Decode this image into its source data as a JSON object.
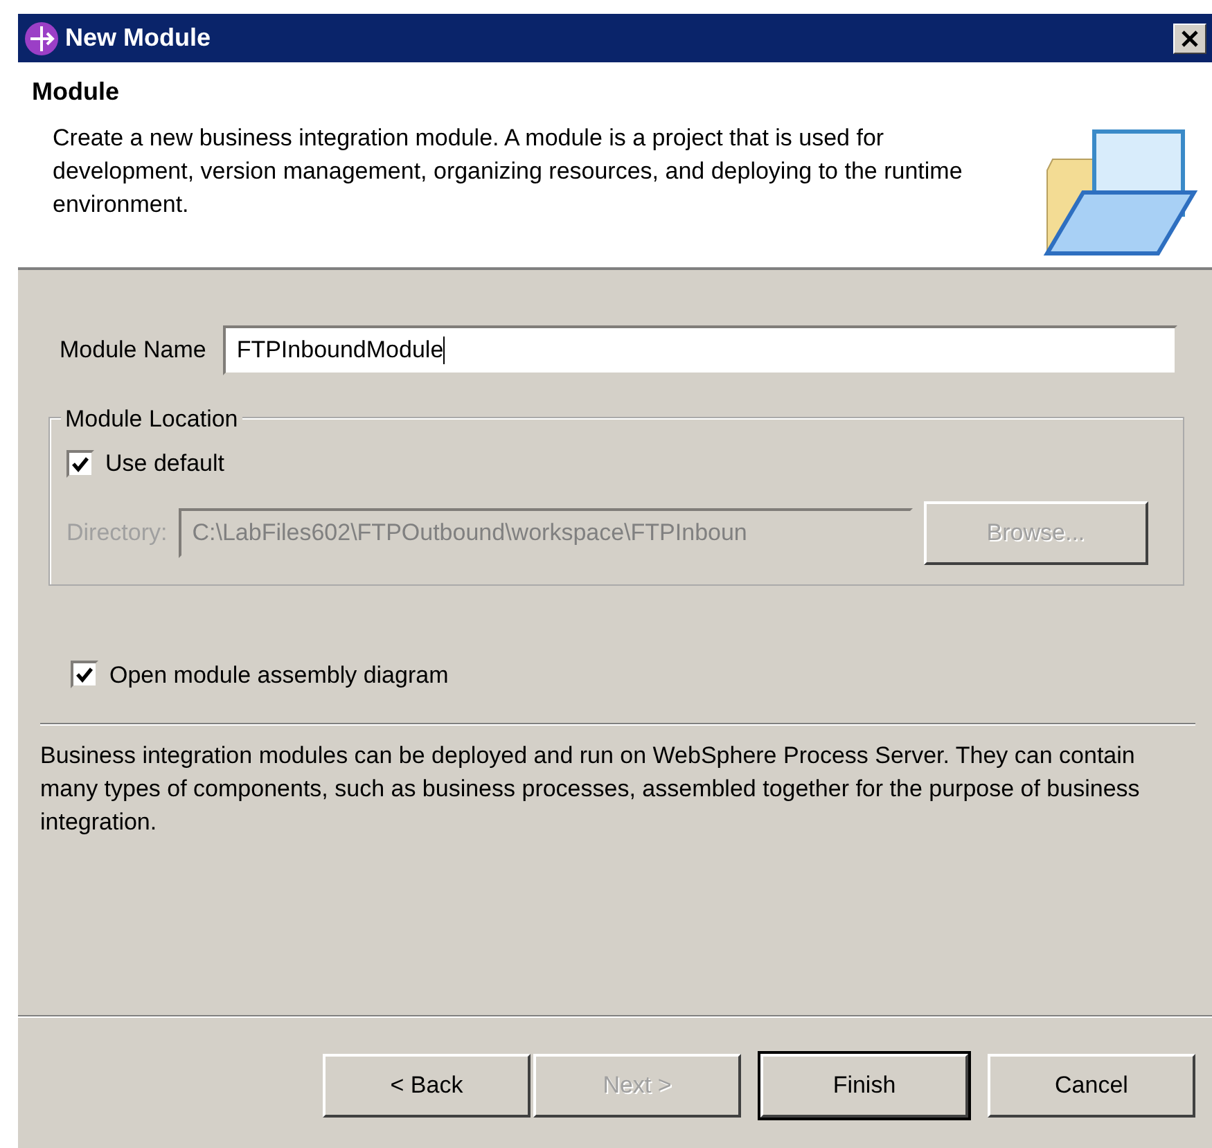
{
  "window": {
    "title": "New Module"
  },
  "header": {
    "title": "Module",
    "description": "Create a new business integration module. A module is a project that is used for development, version management, organizing resources, and deploying to the runtime environment."
  },
  "module_name": {
    "label": "Module Name",
    "value": "FTPInboundModule"
  },
  "location": {
    "legend": "Module Location",
    "use_default": {
      "label": "Use default",
      "checked": true
    },
    "directory": {
      "label": "Directory:",
      "value": "C:\\LabFiles602\\FTPOutbound\\workspace\\FTPInboun",
      "disabled": true
    },
    "browse": {
      "label": "Browse...",
      "disabled": true
    }
  },
  "open_diagram": {
    "label": "Open module assembly diagram",
    "checked": true
  },
  "info": "Business integration modules can be deployed and run on WebSphere Process Server. They can contain many types of components, such as business processes, assembled together for the purpose of business integration.",
  "buttons": [
    {
      "label": "< Back",
      "disabled": false,
      "default": false
    },
    {
      "label": "Next >",
      "disabled": true,
      "default": false
    },
    {
      "label": "Finish",
      "disabled": false,
      "default": true
    },
    {
      "label": "Cancel",
      "disabled": false,
      "default": false
    }
  ]
}
